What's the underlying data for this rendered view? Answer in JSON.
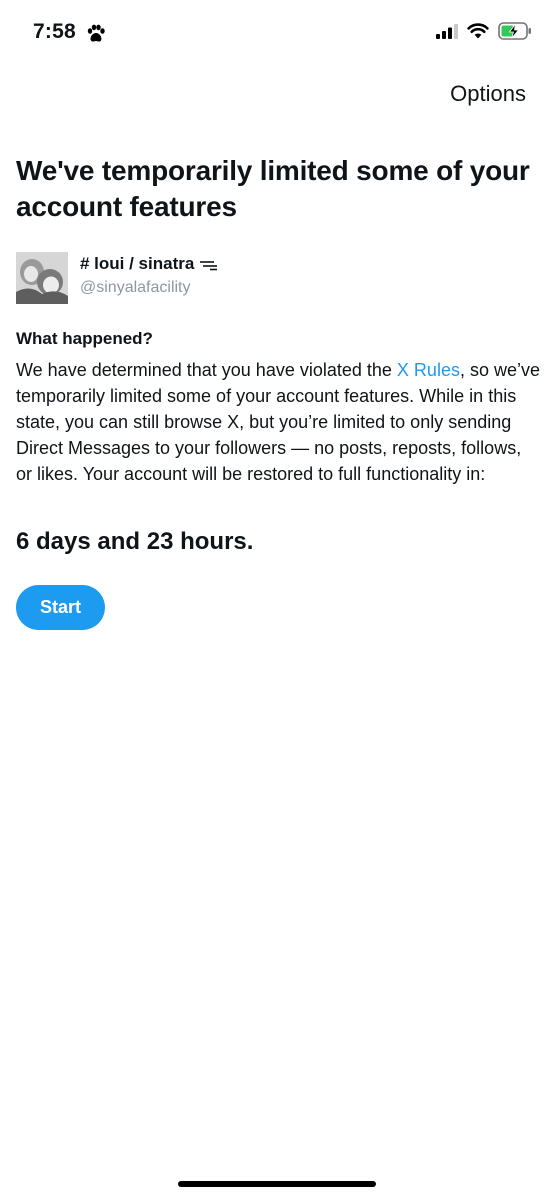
{
  "status_bar": {
    "time": "7:58",
    "icons": [
      "paw-icon",
      "signal-icon",
      "wifi-icon",
      "battery-charging-icon"
    ]
  },
  "header": {
    "options_label": "Options"
  },
  "headline": "We've temporarily limited some of your account features",
  "profile": {
    "display_name": "# loui / sinatra",
    "handle": "@sinyalafacility"
  },
  "what_happened": {
    "title": "What happened?",
    "text_before": "We have determined that you have violated the ",
    "link_text": "X Rules",
    "text_after": ", so we’ve temporarily limited some of your account features. While in this state, you can still browse X, but you’re limited to only sending Direct Messages to your followers — no posts, reposts, follows, or likes. Your account will be restored to full functionality in:"
  },
  "restore_time": "6 days and 23 hours.",
  "start_button": "Start",
  "colors": {
    "accent": "#1d9bf0",
    "text": "#0f1419",
    "secondary": "#8b98a5",
    "battery": "#34c759"
  }
}
